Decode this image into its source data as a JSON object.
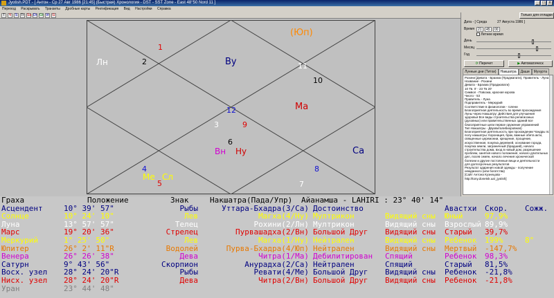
{
  "window": {
    "title": "Jyotish.PDT - [ Антон - Ср 27 Авг 1986 [21:45] (Быстрая) Хронология - DST - SST Zone - East 48°50 Nord 11 ]",
    "min_label": "_",
    "max_label": "□",
    "close_label": "x"
  },
  "menu": [
    "Переход",
    "Раскрывать",
    "Транзиты",
    "Дробные карты",
    "Ректификация",
    "Вид",
    "Настройки",
    "Справка"
  ],
  "toolbar": {
    "buttons": [
      "T",
      "Ч",
      "S",
      "Tr",
      "Sa",
      "Dr",
      "Gr",
      "Vr",
      "G"
    ]
  },
  "chart": {
    "houses": [
      {
        "num": "1",
        "color": "#e00000"
      },
      {
        "num": "2",
        "color": "#000000"
      },
      {
        "num": "3",
        "color": "#ffffff"
      },
      {
        "num": "4",
        "color": "#1010d0"
      },
      {
        "num": "5",
        "color": "#e00000"
      },
      {
        "num": "6",
        "color": "#000000"
      },
      {
        "num": "7",
        "color": "#ffffff"
      },
      {
        "num": "8",
        "color": "#1010d0"
      },
      {
        "num": "9",
        "color": "#e00000"
      },
      {
        "num": "10",
        "color": "#000000"
      },
      {
        "num": "11",
        "color": "#ffffff"
      },
      {
        "num": "12",
        "color": "#1010d0"
      }
    ],
    "planets": [
      {
        "name": "Лн",
        "color": "#ffffff"
      },
      {
        "name": "Ву",
        "color": "#000080"
      },
      {
        "name": "(Юп)",
        "color": "#ff8800"
      },
      {
        "name": "Ма",
        "color": "#d00000"
      },
      {
        "name": "Вн",
        "color": "#d000d0"
      },
      {
        "name": "Ну",
        "color": "#d00000"
      },
      {
        "name": "Са",
        "color": "#000080"
      },
      {
        "name": "Ме",
        "color": "#ffff00"
      },
      {
        "name": "Сл",
        "color": "#ffff00"
      }
    ]
  },
  "right_panel": {
    "today_button": "Только для отладки",
    "date_label": "Дата - [ Среда",
    "date_value": "27 Августа 1986 ]",
    "time_label": "Время",
    "time_h": "21",
    "time_m": "45",
    "time_s": "00",
    "dst_label": "Летнее время",
    "day_label": "День",
    "month_label": "Месяц",
    "year_label": "Год",
    "redraw_button": "Перечет",
    "transit_button": "Автоматическ",
    "tabs": [
      "Лунные дни (Титхи)",
      "Накшатра",
      "Даши",
      "Мухурта"
    ],
    "active_tab": "Накшатра",
    "nakshatra_text": [
      "Рохини [Девата - Брахма (Праджапати), Правитель - Луна",
      "Название - Рохини",
      "Девата - Брахма (Праджапати)",
      "10 Тв. 0' - 23 Тв 20'",
      "Символ - Повозка, красная корова",
      "Число - 53",
      "Правитель - Луна",
      "Подправитель - Меркурий",
      "Соответствие в физиологии - голени",
      "Благоприятная деятельность во время прохождения",
      "Луны через Накшатру:  Действия для улучшения",
      "здоровья Все виды строительства религиозных",
      "(духовных) или правительственных зданий все",
      "благоприятные цели первое оружение упражнений",
      "Тип Накшатры - Двухвиталибиоровная)",
      "Благоприятная деятельность при прохождении Чандры по этому",
      "полу накшатры:  Коронация, брак, важные обета акти,",
      "священные церемонии, крещение, прощение,",
      "искусственная, покупка деревней, основание города,",
      "покупка земли, заграничный (брадший), начало",
      "строительства дома, вход в новый дом, разрешение",
      "проблем, занятия нового положения, начало длительных",
      "дел, посев семян, начало лечения хронической",
      "болезни и другие постоянные вещи и деятельности",
      "для долгосрочных результатов",
      "Результат одарения новой одежды - получение",
      "нежданного (или богатства)",
      "[Сайт Антона Кузнецова -",
      "http://tony.donetsk.ua/_jyotish]"
    ]
  },
  "table": {
    "header": {
      "graha": "Граха",
      "position": "Положение",
      "sign": "Знак",
      "nakshatra": "Накшатра(Пада/Упр)",
      "ayanamsha": "Айанамша - LAHIRI :  23° 40' 14\""
    },
    "rows": [
      {
        "graha": "Асцендент",
        "pos": "10° 39' 57\"",
        "sign": "Рыбы",
        "nak": "Уттара-Бхадра(3/Са)",
        "status": "Достоинство",
        "avastha": "",
        "state": "Авастхи",
        "age": "Скор.",
        "speed": "Сожж.",
        "color": "#000080"
      },
      {
        "graha": "Солнце",
        "pos": "10° 24' 10\"",
        "sign": "Лев",
        "nak": "Магха(4/Ну)",
        "status": "Мултрикон",
        "avastha": "Видящий сны",
        "state": "Юный",
        "age": "97,9%",
        "speed": "",
        "color": "#ffff00"
      },
      {
        "graha": "Луна",
        "pos": "13° 57' 57\"",
        "sign": "Телец",
        "nak": "Рохини(2/Лн)",
        "status": "Мултрикон",
        "avastha": "Видящий сны",
        "state": "Взрослый",
        "age": "89,9%",
        "speed": "",
        "color": "#ffffff"
      },
      {
        "graha": "Марс",
        "pos": "19° 20' 36\"",
        "sign": "Стрелец",
        "nak": "Пурвашадха(2/Вн)",
        "status": "Большой Друг",
        "avastha": "Видящий сны",
        "state": "Старый",
        "age": "39,7%",
        "speed": "",
        "color": "#e00000"
      },
      {
        "graha": "Меркурий",
        "pos": "1° 25' 50\"",
        "sign": "Лев",
        "nak": "Магха(1/Ну)",
        "status": "Нейтрален",
        "avastha": "Видящий сны",
        "state": "Ребенок",
        "age": "199%",
        "speed": "8°",
        "color": "#ffff00"
      },
      {
        "graha": "Юпитер",
        "pos": "26° 2' 11\"R",
        "sign": "Водолей",
        "nak": "Пурва-Бхадра(4/Юп)",
        "status": "Нейтрален",
        "avastha": "Видящий сны",
        "state": "Мертвый",
        "age": "-147,7%",
        "speed": "",
        "color": "#e87800"
      },
      {
        "graha": "Венера",
        "pos": "26° 26' 38\"",
        "sign": "Дева",
        "nak": "Читра(1/Ма)",
        "status": "Дебилитирован",
        "avastha": "Спящий",
        "state": "Ребенок",
        "age": "98,3%",
        "speed": "",
        "color": "#d000d0"
      },
      {
        "graha": "Сатурн",
        "pos": "9° 43' 56\"",
        "sign": "Скорпион",
        "nak": "Анурадха(2/Са)",
        "status": "Нейтрален",
        "avastha": "Спящий",
        "state": "Старый",
        "age": "81,5%",
        "speed": "",
        "color": "#000080"
      },
      {
        "graha": "Восх. узел",
        "pos": "28° 24' 20\"R",
        "sign": "Рыбы",
        "nak": "Ревати(4/Ме)",
        "status": "Большой Друг",
        "avastha": "Видящий сны",
        "state": "Ребенок",
        "age": "-21,8%",
        "speed": "",
        "color": "#000080"
      },
      {
        "graha": "Нисх. узел",
        "pos": "28° 24' 20\"R",
        "sign": "Дева",
        "nak": "Читра(2/Вн)",
        "status": "Большой Друг",
        "avastha": "Видящий сны",
        "state": "Ребенок",
        "age": "-21,8%",
        "speed": "",
        "color": "#e00000"
      },
      {
        "graha": "Уран",
        "pos": "23° 44' 48\"",
        "sign": "",
        "nak": "",
        "status": "",
        "avastha": "",
        "state": "",
        "age": "",
        "speed": "",
        "color": "#808080"
      }
    ]
  }
}
